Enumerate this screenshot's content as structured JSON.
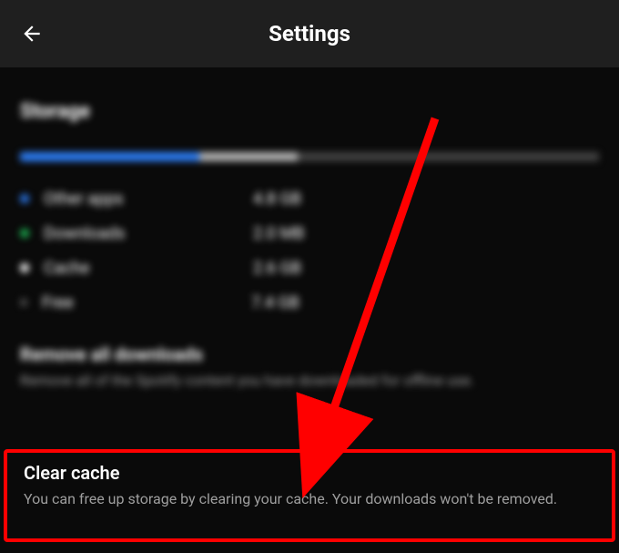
{
  "header": {
    "title": "Settings"
  },
  "storage": {
    "section_title": "Storage",
    "bar": {
      "blue_pct": 31,
      "grey_pct": 17,
      "dark_pct": 52
    },
    "legend": [
      {
        "label": "Other apps",
        "value": "4.8 GB",
        "color": "blue"
      },
      {
        "label": "Downloads",
        "value": "2.0 MB",
        "color": "green"
      },
      {
        "label": "Cache",
        "value": "2.6 GB",
        "color": "white"
      },
      {
        "label": "Free",
        "value": "7.4 GB",
        "color": "hollow"
      }
    ]
  },
  "remove_downloads": {
    "title": "Remove all downloads",
    "desc": "Remove all of the Spotify content you have downloaded for offline use."
  },
  "clear_cache": {
    "title": "Clear cache",
    "desc": "You can free up storage by clearing your cache. Your downloads won't be removed."
  },
  "annotation": {
    "highlight_color": "#ff0000"
  }
}
